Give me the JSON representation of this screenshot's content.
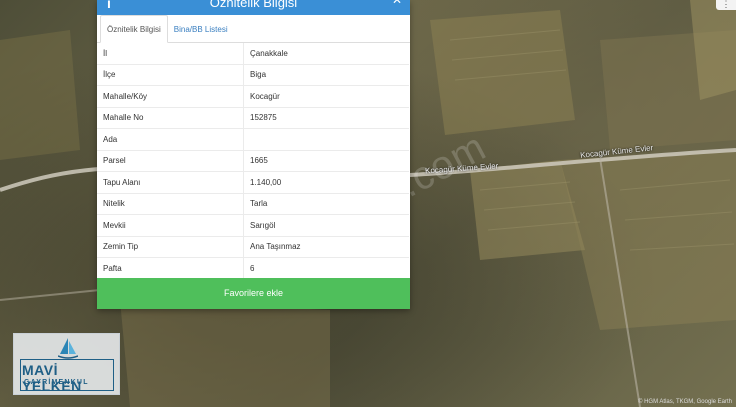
{
  "panel": {
    "title": "Öznitelik Bilgisi",
    "tabs": [
      "Öznitelik Bilgisi",
      "Bina/BB Listesi"
    ],
    "rows": [
      {
        "key": "İl",
        "value": "Çanakkale"
      },
      {
        "key": "İlçe",
        "value": "Biga"
      },
      {
        "key": "Mahalle/Köy",
        "value": "Kocagür"
      },
      {
        "key": "Mahalle No",
        "value": "152875"
      },
      {
        "key": "Ada",
        "value": ""
      },
      {
        "key": "Parsel",
        "value": "1665"
      },
      {
        "key": "Tapu Alanı",
        "value": "1.140,00"
      },
      {
        "key": "Nitelik",
        "value": "Tarla"
      },
      {
        "key": "Mevkii",
        "value": "Sarıgöl"
      },
      {
        "key": "Zemin Tip",
        "value": "Ana Taşınmaz"
      },
      {
        "key": "Pafta",
        "value": "6"
      }
    ],
    "favorite_button": "Favorilere ekle"
  },
  "map": {
    "watermark": "emlakjet.com",
    "road_labels": [
      "Kocagür Küme Evler",
      "Kocagür Küme Evler"
    ],
    "attribution": "© HGM Atlas, TKGM, Google Earth"
  },
  "logo": {
    "brand": "MAVİ YELKEN",
    "sub": "GAYRİMENKUL"
  },
  "colors": {
    "header": "#3a8fd6",
    "favorite_button": "#4fbf5b",
    "logo_blue": "#1f5f86"
  }
}
